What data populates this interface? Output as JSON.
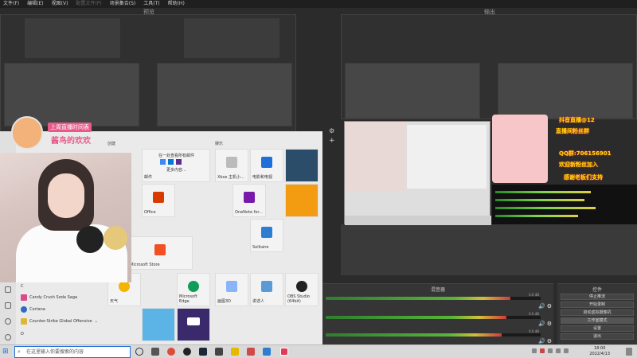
{
  "menubar": {
    "items": [
      "文件(F)",
      "编辑(E)",
      "视图(V)",
      "场景集合(S)",
      "工具(T)",
      "帮助(H)"
    ],
    "disabled": [
      "配置文件(P)"
    ]
  },
  "panes": {
    "preview_title": "预览",
    "output_title": "输出"
  },
  "streamer": {
    "banner_title": "上周直播时间表",
    "banner_name": "酱鸟的欢欢"
  },
  "start_menu": {
    "group_create": "创建",
    "group_play": "娱乐",
    "mail_tile_text": "在一处查看所有邮件",
    "mail_tile_more": "更多内容...",
    "tiles": {
      "mail": "邮件",
      "xbox": "Xbox 主机小...",
      "movies": "电影和电视",
      "office": "Office",
      "onenote": "OneNote for...",
      "solitaire": "Solitaire",
      "store": "Microsoft Store",
      "weather": "天气",
      "edge": "Microsoft Edge",
      "calc": "画图3D",
      "sound": "讲述人",
      "obs": "OBS Studio (64bit)"
    },
    "list_header": "C",
    "list_items": [
      "Candy Crush Soda Saga",
      "Cortana",
      "Counter-Strike Global Offensive"
    ],
    "list_footer": "D"
  },
  "right_overlay": {
    "line1": "抖音直播@12",
    "line2": "直播间粉丝群",
    "line3": "QQ群:706156901",
    "line4": "欢迎新粉丝加入",
    "line5": "感谢老板们支持"
  },
  "mixer": {
    "title": "混音器",
    "channels": [
      {
        "level": 0.86,
        "db_label": "0.0 dB"
      },
      {
        "level": 0.84,
        "db_label": "0.0 dB"
      },
      {
        "level": 0.82,
        "db_label": "0.0 dB"
      }
    ]
  },
  "controls": {
    "title": "控件",
    "buttons": [
      "停止推流",
      "开始录制",
      "启动虚拟摄像机",
      "工作室模式",
      "设置",
      "退出"
    ],
    "active_index": 3
  },
  "taskbar": {
    "search_placeholder": "在这里输入你要搜索的内容",
    "time": "18:00",
    "date": "2022/4/13"
  },
  "colors": {
    "accent_pink": "#e85a8a",
    "windows_blue": "#1e6fd9",
    "meter_green": "#58b43a"
  }
}
